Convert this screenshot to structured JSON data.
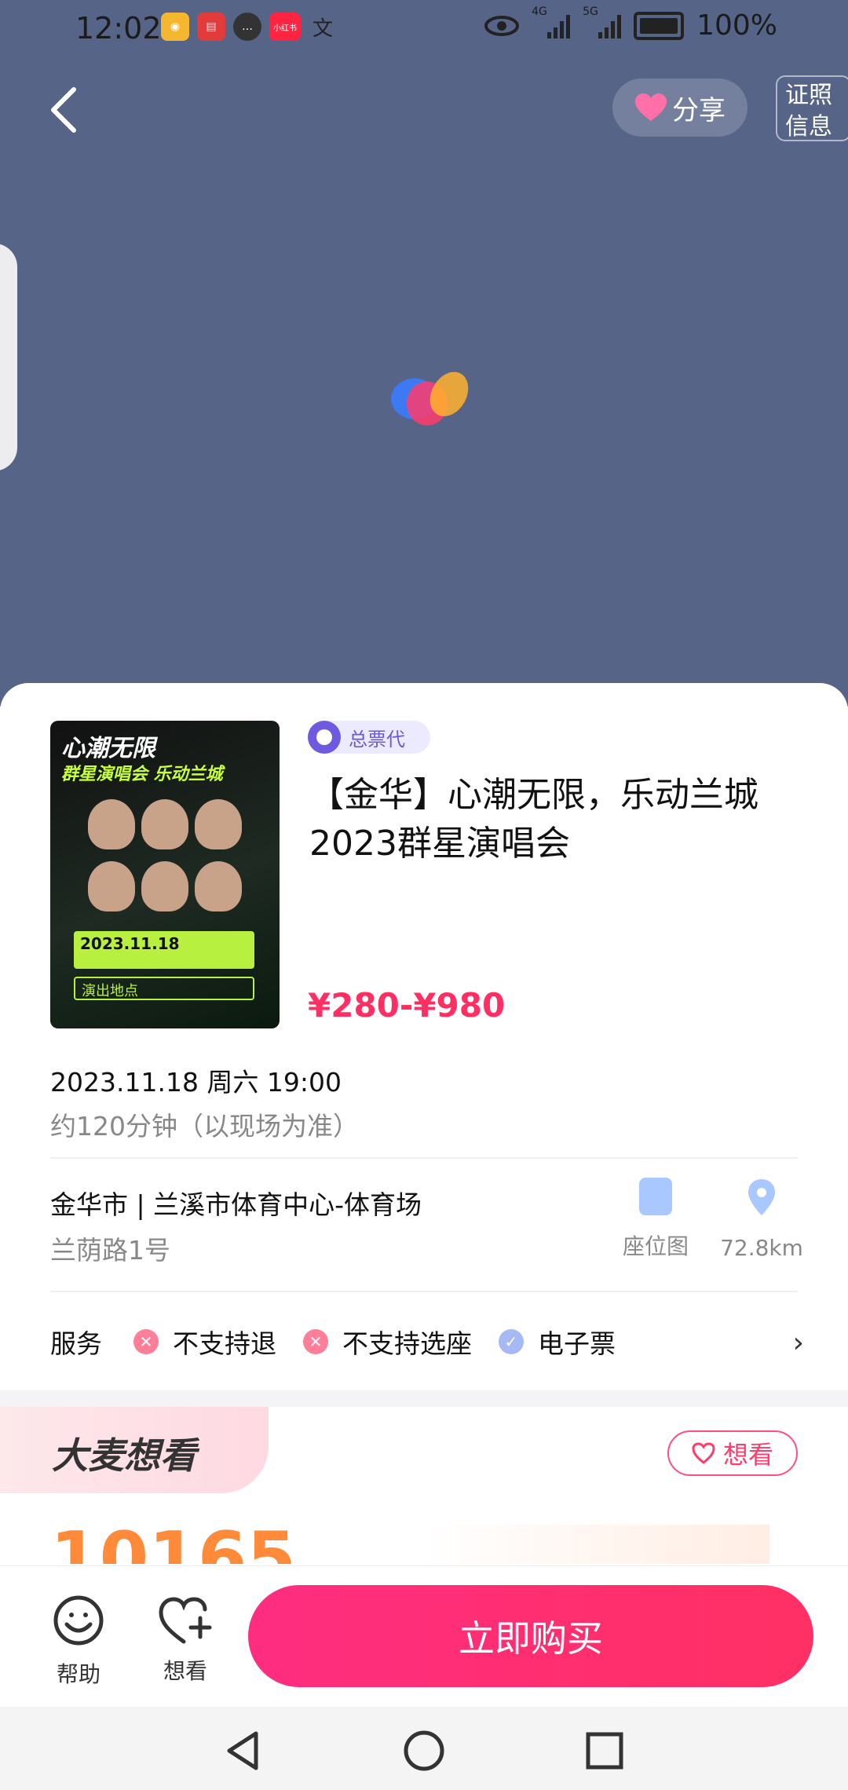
{
  "status_bar": {
    "time": "12:02",
    "network_1": "4G",
    "network_2": "5G",
    "battery": "100%",
    "app_icons": [
      "weibo-icon",
      "book-icon",
      "chat-icon",
      "xiaohongshu-icon",
      "translate-icon"
    ],
    "xhs_label": "小红书"
  },
  "header": {
    "share_label": "分享",
    "license_label_line1": "证照",
    "license_label_line2": "信息"
  },
  "event": {
    "agent_badge": "总票代",
    "title": "【金华】心潮无限，乐动兰城2023群星演唱会",
    "price": "¥280-¥980",
    "datetime": "2023.11.18 周六 19:00",
    "duration": "约120分钟（以现场为准）",
    "venue": "金华市 | 兰溪市体育中心-体育场",
    "address": "兰荫路1号",
    "seat_map_label": "座位图",
    "distance": "72.8km"
  },
  "poster": {
    "title": "心潮无限",
    "subtitle": "群星演唱会 乐动兰城",
    "date": "2023.11.18",
    "place_label": "演出地点"
  },
  "services": {
    "label": "服务",
    "items": [
      {
        "text": "不支持退",
        "ok": false
      },
      {
        "text": "不支持选座",
        "ok": false
      },
      {
        "text": "电子票",
        "ok": true
      }
    ]
  },
  "want_section": {
    "banner": "大麦想看",
    "want_button": "想看",
    "count": "10165"
  },
  "bottom_bar": {
    "help_label": "帮助",
    "want_label": "想看",
    "buy_label": "立即购买"
  },
  "colors": {
    "hero_bg": "#566488",
    "accent": "#ff2e63",
    "count": "#ff8a3a"
  }
}
